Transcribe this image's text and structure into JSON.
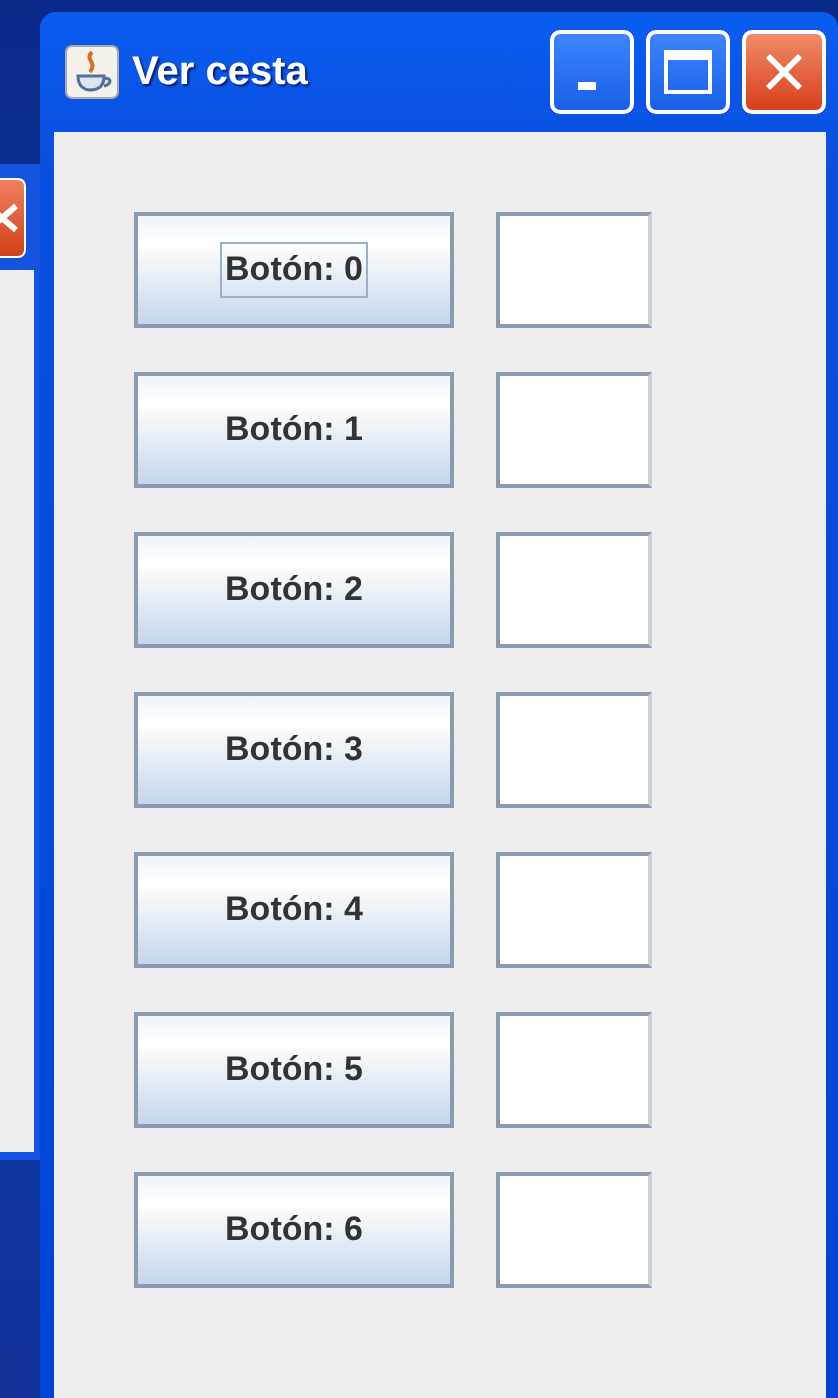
{
  "window": {
    "title": "Ver cesta"
  },
  "rows": [
    {
      "button": "Botón: 0",
      "focused": true
    },
    {
      "button": "Botón: 1",
      "focused": false
    },
    {
      "button": "Botón: 2",
      "focused": false
    },
    {
      "button": "Botón: 3",
      "focused": false
    },
    {
      "button": "Botón: 4",
      "focused": false
    },
    {
      "button": "Botón: 5",
      "focused": false
    },
    {
      "button": "Botón: 6",
      "focused": false
    }
  ]
}
